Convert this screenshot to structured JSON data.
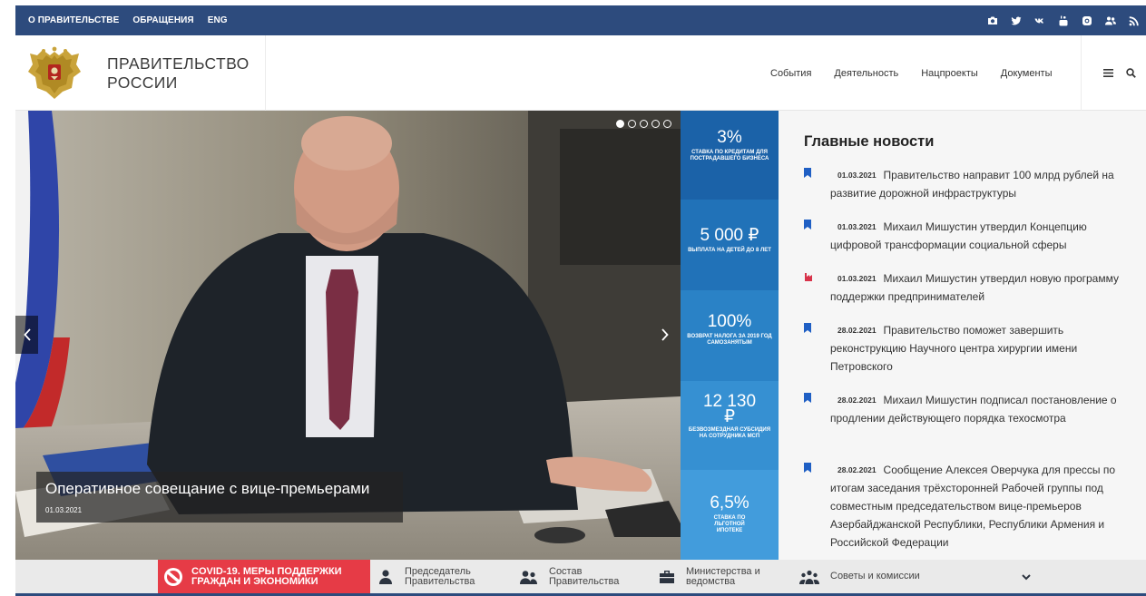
{
  "topbar": {
    "links": [
      "О ПРАВИТЕЛЬСТВЕ",
      "ОБРАЩЕНИЯ",
      "ENG"
    ],
    "socials": [
      "camera-icon",
      "twitter-icon",
      "vk-icon",
      "youtube-icon",
      "instagram-icon",
      "users-icon",
      "rss-icon"
    ]
  },
  "header": {
    "brand_line1": "ПРАВИТЕЛЬСТВО",
    "brand_line2": "РОССИИ",
    "nav": [
      "События",
      "Деятельность",
      "Нацпроекты",
      "Документы"
    ]
  },
  "slider": {
    "caption_title": "Оперативное совещание с вице-премьерами",
    "caption_date": "01.03.2021",
    "slide_count": 5,
    "active_slide": 1
  },
  "stats": [
    {
      "value": "3%",
      "label": "СТАВКА ПО КРЕДИТАМ ДЛЯ ПОСТРАДАВШЕГО БИЗНЕСА",
      "color": "#1b62a8"
    },
    {
      "value": "5 000 ₽",
      "label": "ВЫПЛАТА НА ДЕТЕЙ ДО 8 ЛЕТ",
      "color": "#2172b8"
    },
    {
      "value": "100%",
      "label": "ВОЗВРАТ НАЛОГА ЗА 2019 ГОД САМОЗАНЯТЫМ",
      "color": "#2a82c6"
    },
    {
      "value": "12 130 ₽",
      "label": "БЕЗВОЗМЕЗДНАЯ СУБСИДИЯ НА СОТРУДНИКА МСП",
      "color": "#3690d2"
    },
    {
      "value": "6,5%",
      "label": "СТАВКА ПО ЛЬГОТНОЙ ИПОТЕКЕ",
      "color": "#429cdc"
    }
  ],
  "news": {
    "title": "Главные новости",
    "items": [
      {
        "date": "01.03.2021",
        "text": "Правительство направит 100 млрд рублей на развитие дорожной инфраструктуры",
        "icon": "bookmark-icon"
      },
      {
        "date": "01.03.2021",
        "text": "Михаил Мишустин утвердил Концепцию цифровой трансформации социальной сферы",
        "icon": "bookmark-icon"
      },
      {
        "date": "01.03.2021",
        "text": "Михаил Мишустин утвердил новую программу поддержки предпринимателей",
        "icon": "factory-icon"
      },
      {
        "date": "28.02.2021",
        "text": "Правительство поможет завершить реконструкцию Научного центра хирургии имени Петровского",
        "icon": "bookmark-icon"
      },
      {
        "date": "28.02.2021",
        "text": "Михаил Мишустин подписал постановление о продлении действующего порядка техосмотра",
        "icon": "bookmark-icon"
      },
      {
        "date": "28.02.2021",
        "text": "Сообщение Алексея Оверчука для прессы по итогам заседания трёхсторонней Рабочей группы под совместным председательством вице-премьеров Азербайджанской Республики, Республики Армения и Российской Федерации",
        "icon": "bookmark-icon"
      }
    ]
  },
  "bottombar": {
    "covid_line1": "COVID-19. МЕРЫ ПОДДЕРЖКИ",
    "covid_line2": "ГРАЖДАН И ЭКОНОМИКИ",
    "items": [
      {
        "line1": "Председатель",
        "line2": "Правительства",
        "icon": "person-icon"
      },
      {
        "line1": "Состав",
        "line2": "Правительства",
        "icon": "group-icon"
      },
      {
        "line1": "Министерства и",
        "line2": "ведомства",
        "icon": "briefcase-icon"
      },
      {
        "line1": "Советы и комиссии",
        "line2": "",
        "icon": "council-icon"
      }
    ]
  },
  "colors": {
    "brand_dark": "#2d4b7d",
    "covid_red": "#e63b46",
    "bookmark_blue": "#1f5fc4",
    "factory_red": "#d8334a"
  }
}
